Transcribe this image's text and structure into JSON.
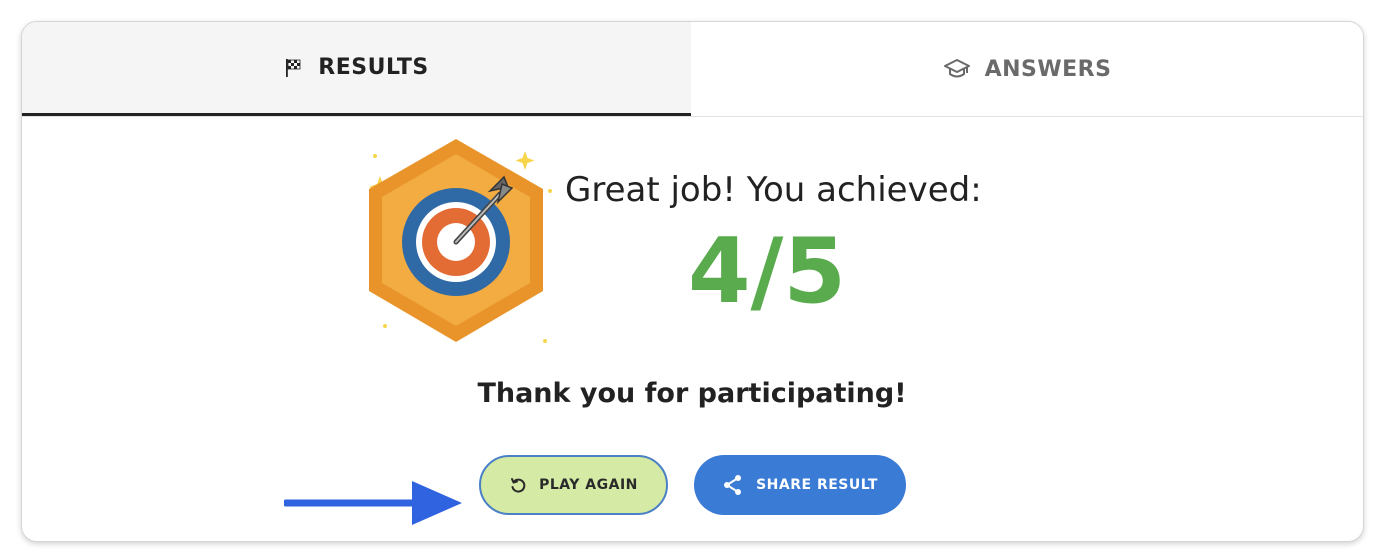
{
  "tabs": {
    "results": {
      "label": "RESULTS",
      "icon": "checkered-flag-icon",
      "active": true
    },
    "answers": {
      "label": "ANSWERS",
      "icon": "graduation-cap-icon",
      "active": false
    }
  },
  "result": {
    "badge_icon": "target-dart-badge-icon",
    "headline": "Great job! You achieved:",
    "score": "4/5",
    "message": "Thank you for participating!"
  },
  "actions": {
    "play_again": {
      "label": "PLAY AGAIN",
      "icon": "replay-icon"
    },
    "share": {
      "label": "SHARE RESULT",
      "icon": "share-icon"
    }
  },
  "annotation": {
    "icon": "arrow-right-icon"
  },
  "colors": {
    "score": "#5aab4e",
    "play_button_bg": "#d5eaa4",
    "share_button_bg": "#3a7bd5",
    "annotation_arrow": "#2f63e0",
    "badge_orange": "#f0a33a"
  }
}
